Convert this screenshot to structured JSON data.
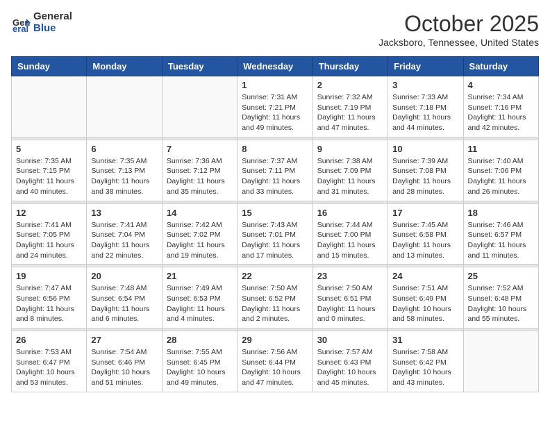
{
  "header": {
    "logo_general": "General",
    "logo_blue": "Blue",
    "month_title": "October 2025",
    "location": "Jacksboro, Tennessee, United States"
  },
  "weekdays": [
    "Sunday",
    "Monday",
    "Tuesday",
    "Wednesday",
    "Thursday",
    "Friday",
    "Saturday"
  ],
  "weeks": [
    [
      {
        "day": "",
        "sunrise": "",
        "sunset": "",
        "daylight": ""
      },
      {
        "day": "",
        "sunrise": "",
        "sunset": "",
        "daylight": ""
      },
      {
        "day": "",
        "sunrise": "",
        "sunset": "",
        "daylight": ""
      },
      {
        "day": "1",
        "sunrise": "Sunrise: 7:31 AM",
        "sunset": "Sunset: 7:21 PM",
        "daylight": "Daylight: 11 hours and 49 minutes."
      },
      {
        "day": "2",
        "sunrise": "Sunrise: 7:32 AM",
        "sunset": "Sunset: 7:19 PM",
        "daylight": "Daylight: 11 hours and 47 minutes."
      },
      {
        "day": "3",
        "sunrise": "Sunrise: 7:33 AM",
        "sunset": "Sunset: 7:18 PM",
        "daylight": "Daylight: 11 hours and 44 minutes."
      },
      {
        "day": "4",
        "sunrise": "Sunrise: 7:34 AM",
        "sunset": "Sunset: 7:16 PM",
        "daylight": "Daylight: 11 hours and 42 minutes."
      }
    ],
    [
      {
        "day": "5",
        "sunrise": "Sunrise: 7:35 AM",
        "sunset": "Sunset: 7:15 PM",
        "daylight": "Daylight: 11 hours and 40 minutes."
      },
      {
        "day": "6",
        "sunrise": "Sunrise: 7:35 AM",
        "sunset": "Sunset: 7:13 PM",
        "daylight": "Daylight: 11 hours and 38 minutes."
      },
      {
        "day": "7",
        "sunrise": "Sunrise: 7:36 AM",
        "sunset": "Sunset: 7:12 PM",
        "daylight": "Daylight: 11 hours and 35 minutes."
      },
      {
        "day": "8",
        "sunrise": "Sunrise: 7:37 AM",
        "sunset": "Sunset: 7:11 PM",
        "daylight": "Daylight: 11 hours and 33 minutes."
      },
      {
        "day": "9",
        "sunrise": "Sunrise: 7:38 AM",
        "sunset": "Sunset: 7:09 PM",
        "daylight": "Daylight: 11 hours and 31 minutes."
      },
      {
        "day": "10",
        "sunrise": "Sunrise: 7:39 AM",
        "sunset": "Sunset: 7:08 PM",
        "daylight": "Daylight: 11 hours and 28 minutes."
      },
      {
        "day": "11",
        "sunrise": "Sunrise: 7:40 AM",
        "sunset": "Sunset: 7:06 PM",
        "daylight": "Daylight: 11 hours and 26 minutes."
      }
    ],
    [
      {
        "day": "12",
        "sunrise": "Sunrise: 7:41 AM",
        "sunset": "Sunset: 7:05 PM",
        "daylight": "Daylight: 11 hours and 24 minutes."
      },
      {
        "day": "13",
        "sunrise": "Sunrise: 7:41 AM",
        "sunset": "Sunset: 7:04 PM",
        "daylight": "Daylight: 11 hours and 22 minutes."
      },
      {
        "day": "14",
        "sunrise": "Sunrise: 7:42 AM",
        "sunset": "Sunset: 7:02 PM",
        "daylight": "Daylight: 11 hours and 19 minutes."
      },
      {
        "day": "15",
        "sunrise": "Sunrise: 7:43 AM",
        "sunset": "Sunset: 7:01 PM",
        "daylight": "Daylight: 11 hours and 17 minutes."
      },
      {
        "day": "16",
        "sunrise": "Sunrise: 7:44 AM",
        "sunset": "Sunset: 7:00 PM",
        "daylight": "Daylight: 11 hours and 15 minutes."
      },
      {
        "day": "17",
        "sunrise": "Sunrise: 7:45 AM",
        "sunset": "Sunset: 6:58 PM",
        "daylight": "Daylight: 11 hours and 13 minutes."
      },
      {
        "day": "18",
        "sunrise": "Sunrise: 7:46 AM",
        "sunset": "Sunset: 6:57 PM",
        "daylight": "Daylight: 11 hours and 11 minutes."
      }
    ],
    [
      {
        "day": "19",
        "sunrise": "Sunrise: 7:47 AM",
        "sunset": "Sunset: 6:56 PM",
        "daylight": "Daylight: 11 hours and 8 minutes."
      },
      {
        "day": "20",
        "sunrise": "Sunrise: 7:48 AM",
        "sunset": "Sunset: 6:54 PM",
        "daylight": "Daylight: 11 hours and 6 minutes."
      },
      {
        "day": "21",
        "sunrise": "Sunrise: 7:49 AM",
        "sunset": "Sunset: 6:53 PM",
        "daylight": "Daylight: 11 hours and 4 minutes."
      },
      {
        "day": "22",
        "sunrise": "Sunrise: 7:50 AM",
        "sunset": "Sunset: 6:52 PM",
        "daylight": "Daylight: 11 hours and 2 minutes."
      },
      {
        "day": "23",
        "sunrise": "Sunrise: 7:50 AM",
        "sunset": "Sunset: 6:51 PM",
        "daylight": "Daylight: 11 hours and 0 minutes."
      },
      {
        "day": "24",
        "sunrise": "Sunrise: 7:51 AM",
        "sunset": "Sunset: 6:49 PM",
        "daylight": "Daylight: 10 hours and 58 minutes."
      },
      {
        "day": "25",
        "sunrise": "Sunrise: 7:52 AM",
        "sunset": "Sunset: 6:48 PM",
        "daylight": "Daylight: 10 hours and 55 minutes."
      }
    ],
    [
      {
        "day": "26",
        "sunrise": "Sunrise: 7:53 AM",
        "sunset": "Sunset: 6:47 PM",
        "daylight": "Daylight: 10 hours and 53 minutes."
      },
      {
        "day": "27",
        "sunrise": "Sunrise: 7:54 AM",
        "sunset": "Sunset: 6:46 PM",
        "daylight": "Daylight: 10 hours and 51 minutes."
      },
      {
        "day": "28",
        "sunrise": "Sunrise: 7:55 AM",
        "sunset": "Sunset: 6:45 PM",
        "daylight": "Daylight: 10 hours and 49 minutes."
      },
      {
        "day": "29",
        "sunrise": "Sunrise: 7:56 AM",
        "sunset": "Sunset: 6:44 PM",
        "daylight": "Daylight: 10 hours and 47 minutes."
      },
      {
        "day": "30",
        "sunrise": "Sunrise: 7:57 AM",
        "sunset": "Sunset: 6:43 PM",
        "daylight": "Daylight: 10 hours and 45 minutes."
      },
      {
        "day": "31",
        "sunrise": "Sunrise: 7:58 AM",
        "sunset": "Sunset: 6:42 PM",
        "daylight": "Daylight: 10 hours and 43 minutes."
      },
      {
        "day": "",
        "sunrise": "",
        "sunset": "",
        "daylight": ""
      }
    ]
  ]
}
